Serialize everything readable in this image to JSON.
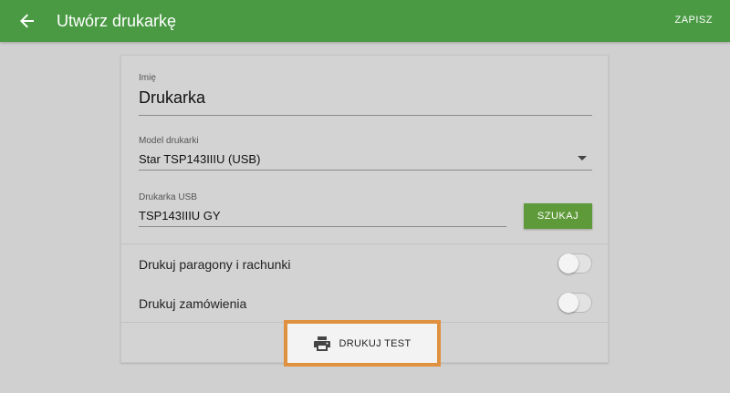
{
  "appbar": {
    "title": "Utwórz drukarkę",
    "save_label": "ZAPISZ",
    "back_icon": "arrow-left-icon",
    "color": "#4a9a44"
  },
  "form": {
    "name": {
      "label": "Imię",
      "value": "Drukarka"
    },
    "model": {
      "label": "Model drukarki",
      "value": "Star TSP143IIIU (USB)"
    },
    "usb": {
      "label": "Drukarka USB",
      "value": "TSP143IIIU GY",
      "search_label": "SZUKAJ"
    }
  },
  "toggles": [
    {
      "label": "Drukuj paragony i rachunki",
      "on": false
    },
    {
      "label": "Drukuj zamówienia",
      "on": false
    }
  ],
  "print_test": {
    "label": "DRUKUJ TEST",
    "icon": "printer-icon",
    "highlight_color": "#e0913f"
  }
}
